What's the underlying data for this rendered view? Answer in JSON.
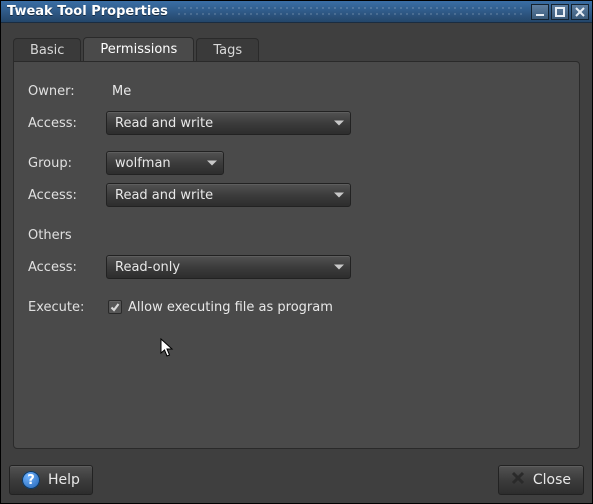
{
  "window": {
    "title": "Tweak Tool Properties"
  },
  "tabs": [
    {
      "label": "Basic"
    },
    {
      "label": "Permissions"
    },
    {
      "label": "Tags"
    }
  ],
  "active_tab_index": 1,
  "permissions": {
    "owner": {
      "label": "Owner:",
      "value": "Me",
      "access_label": "Access:",
      "access_value": "Read and write"
    },
    "group": {
      "label": "Group:",
      "value": "wolfman",
      "access_label": "Access:",
      "access_value": "Read and write"
    },
    "others": {
      "heading": "Others",
      "access_label": "Access:",
      "access_value": "Read-only"
    },
    "execute": {
      "label": "Execute:",
      "checkbox_label": "Allow executing file as program",
      "checked": true
    }
  },
  "footer": {
    "help_label": "Help",
    "close_label": "Close"
  }
}
